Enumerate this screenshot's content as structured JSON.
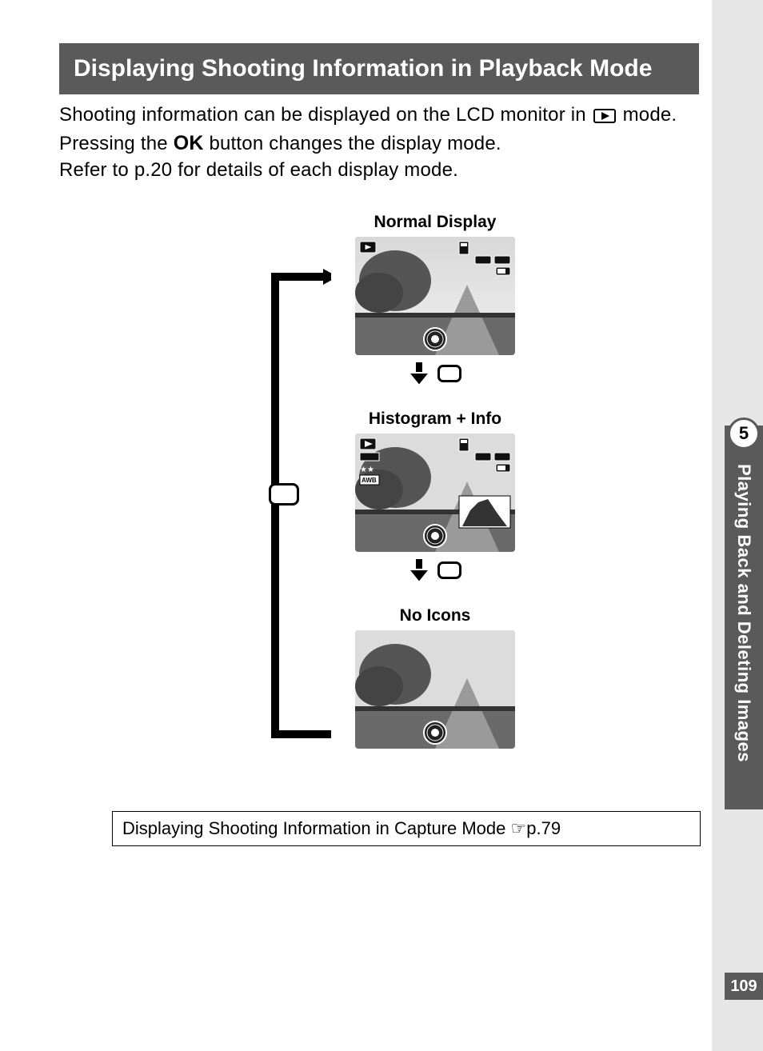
{
  "title": "Displaying Shooting Information in Playback Mode",
  "intro": {
    "line1_a": "Shooting information can be displayed on the LCD monitor in ",
    "line1_b": " mode.",
    "line2_a": "Pressing the ",
    "line2_ok": "OK",
    "line2_b": " button changes the display mode.",
    "line3": "Refer to p.20 for details of each display mode."
  },
  "modes": {
    "normal": "Normal Display",
    "histogram": "Histogram + Info",
    "noicons": "No Icons"
  },
  "xref": {
    "text": "Displaying Shooting Information in Capture Mode ",
    "hand": "☞",
    "page": "p.79"
  },
  "side": {
    "chapter": "5",
    "label": "Playing Back and Deleting Images"
  },
  "page_number": "109",
  "icons": {
    "playback": "playback-icon",
    "card": "memory-card-icon",
    "sound_key": "sound-key-icons",
    "battery": "battery-icon",
    "stars": "★★",
    "awb": "AWB",
    "histogram": "histogram-icon",
    "control_dial": "control-dial-icon"
  }
}
